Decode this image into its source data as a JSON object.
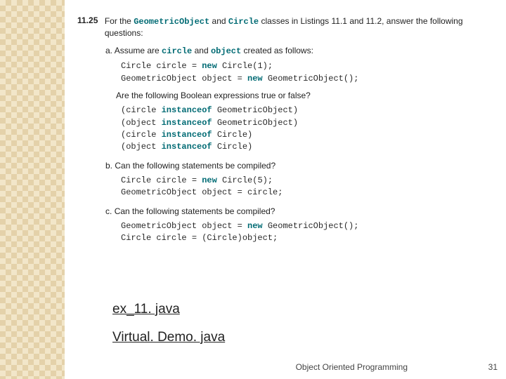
{
  "exercise": {
    "number": "11.25",
    "intro_pre": "For the ",
    "kw1": "GeometricObject",
    "intro_mid": " and ",
    "kw2": "Circle",
    "intro_post": " classes in Listings 11.1 and 11.2, answer the following questions:"
  },
  "part_a": {
    "label": "a.",
    "text_pre": "Assume are ",
    "kw1": "circle",
    "text_mid": " and ",
    "kw2": "object",
    "text_post": " created as follows:",
    "code1_a": "Circle circle = ",
    "code1_new": "new",
    "code1_b": " Circle(1);",
    "code2_a": "GeometricObject object = ",
    "code2_new": "new",
    "code2_b": " GeometricObject();",
    "question": "Are the following Boolean expressions true or false?",
    "e1_a": "(circle ",
    "e1_kw": "instanceof",
    "e1_b": " GeometricObject)",
    "e2_a": "(object ",
    "e2_kw": "instanceof",
    "e2_b": " GeometricObject)",
    "e3_a": "(circle ",
    "e3_kw": "instanceof",
    "e3_b": " Circle)",
    "e4_a": "(object ",
    "e4_kw": "instanceof",
    "e4_b": " Circle)"
  },
  "part_b": {
    "label": "b.",
    "text": "Can the following statements be compiled?",
    "code1_a": "Circle circle = ",
    "code1_new": "new",
    "code1_b": " Circle(5);",
    "code2": "GeometricObject object = circle;"
  },
  "part_c": {
    "label": "c.",
    "text": "Can the following statements be compiled?",
    "code1_a": "GeometricObject object = ",
    "code1_new": "new",
    "code1_b": " GeometricObject();",
    "code2": "Circle circle = (Circle)object;"
  },
  "links": {
    "l1": "ex_11. java",
    "l2": "Virtual. Demo. java"
  },
  "footer": {
    "text": "Object Oriented Programming",
    "page": "31"
  }
}
